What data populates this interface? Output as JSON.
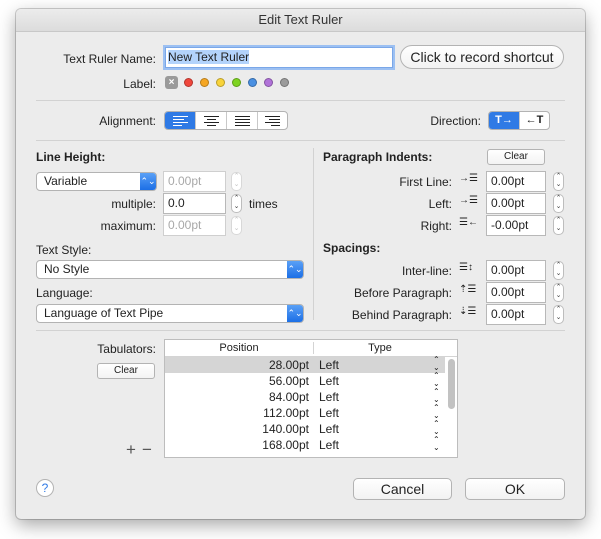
{
  "window": {
    "title": "Edit Text Ruler"
  },
  "name": {
    "label": "Text Ruler Name:",
    "value": "New Text Ruler"
  },
  "shortcut_button": "Click to record shortcut",
  "label_row": {
    "label": "Label:",
    "colors": [
      "#f0473c",
      "#f5a623",
      "#f8d33a",
      "#7ed321",
      "#4a90e2",
      "#b072d8",
      "#9b9b9b"
    ]
  },
  "alignment": {
    "label": "Alignment:",
    "options": [
      "left",
      "center",
      "justify",
      "right"
    ],
    "selected": "left"
  },
  "direction": {
    "label": "Direction:",
    "ltr": "T→",
    "rtl": "←T",
    "selected": "ltr"
  },
  "line_height": {
    "heading": "Line Height:",
    "mode": "Variable",
    "value": "0.00pt",
    "multiple_label": "multiple:",
    "multiple_value": "0.0",
    "times_label": "times",
    "maximum_label": "maximum:",
    "maximum_value": "0.00pt"
  },
  "text_style": {
    "label": "Text Style:",
    "value": "No Style"
  },
  "language": {
    "label": "Language:",
    "value": "Language of Text Pipe"
  },
  "paragraph_indents": {
    "heading": "Paragraph Indents:",
    "clear": "Clear",
    "first_line_label": "First Line:",
    "first_line_value": "0.00pt",
    "left_label": "Left:",
    "left_value": "0.00pt",
    "right_label": "Right:",
    "right_value": "-0.00pt"
  },
  "spacings": {
    "heading": "Spacings:",
    "inter_line_label": "Inter-line:",
    "inter_line_value": "0.00pt",
    "before_label": "Before Paragraph:",
    "before_value": "0.00pt",
    "behind_label": "Behind Paragraph:",
    "behind_value": "0.00pt"
  },
  "tabulators": {
    "label": "Tabulators:",
    "clear": "Clear",
    "add": "+",
    "remove": "−",
    "columns": [
      "Position",
      "Type"
    ],
    "rows": [
      {
        "position": "28.00pt",
        "type": "Left"
      },
      {
        "position": "56.00pt",
        "type": "Left"
      },
      {
        "position": "84.00pt",
        "type": "Left"
      },
      {
        "position": "112.00pt",
        "type": "Left"
      },
      {
        "position": "140.00pt",
        "type": "Left"
      },
      {
        "position": "168.00pt",
        "type": "Left"
      }
    ],
    "selected_row": 0
  },
  "footer": {
    "help": "?",
    "cancel": "Cancel",
    "ok": "OK"
  }
}
